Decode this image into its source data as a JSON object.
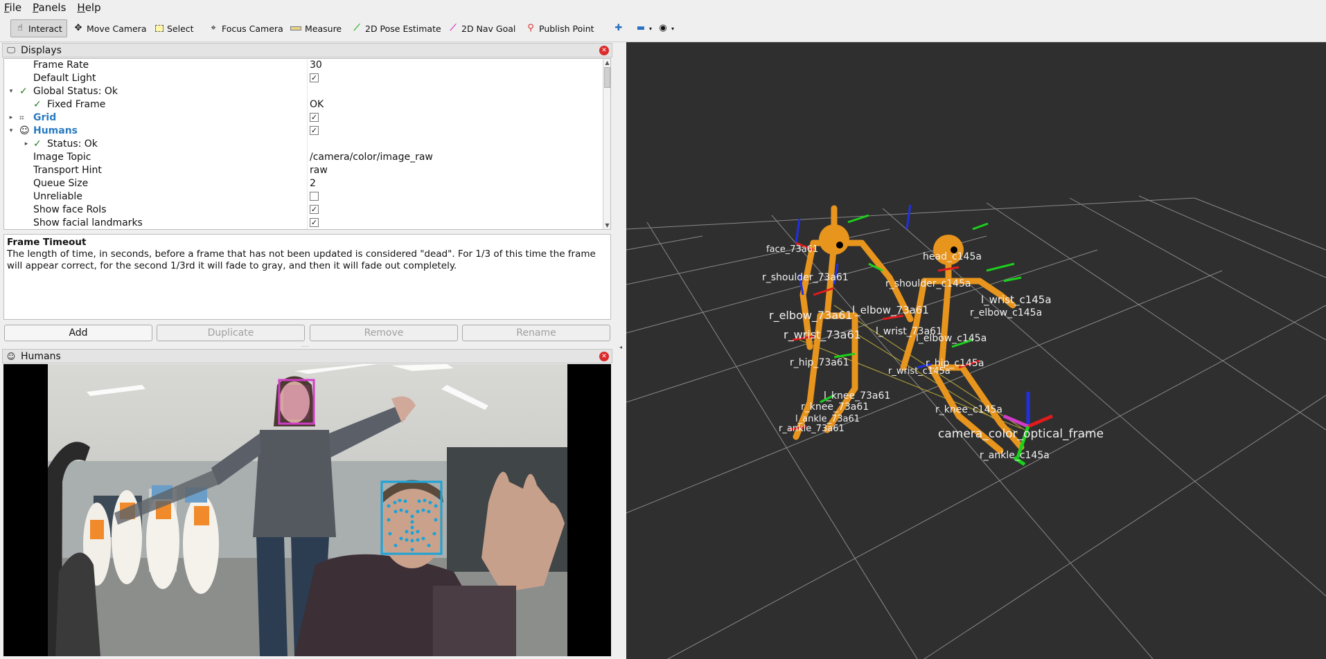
{
  "menu": [
    {
      "first": "F",
      "rest": "ile"
    },
    {
      "first": "P",
      "rest": "anels"
    },
    {
      "first": "H",
      "rest": "elp"
    }
  ],
  "toolbar": {
    "interact": "Interact",
    "move_camera": "Move Camera",
    "select": "Select",
    "focus_camera": "Focus Camera",
    "measure": "Measure",
    "pose_estimate": "2D Pose Estimate",
    "nav_goal": "2D Nav Goal",
    "publish_point": "Publish Point"
  },
  "displays_panel": {
    "title": "Displays",
    "rows": [
      {
        "label": "Frame Rate",
        "value": "30"
      },
      {
        "label": "Default Light",
        "checked": "✓"
      },
      {
        "label": "Global Status: Ok"
      },
      {
        "label": "Fixed Frame",
        "value": "OK"
      },
      {
        "label": "Grid",
        "checked": "✓"
      },
      {
        "label": "Humans",
        "checked": "✓"
      },
      {
        "label": "Status: Ok"
      },
      {
        "label": "Image Topic",
        "value": "/camera/color/image_raw"
      },
      {
        "label": "Transport Hint",
        "value": "raw"
      },
      {
        "label": "Queue Size",
        "value": "2"
      },
      {
        "label": "Unreliable",
        "checked": ""
      },
      {
        "label": "Show face RoIs",
        "checked": "✓"
      },
      {
        "label": "Show facial landmarks",
        "checked": "✓"
      }
    ]
  },
  "description": {
    "title": "Frame Timeout",
    "text": "The length of time, in seconds, before a frame that has not been updated is considered \"dead\". For 1/3 of this time the frame will appear correct, for the second 1/3rd it will fade to gray, and then it will fade out completely."
  },
  "buttons": {
    "add": "Add",
    "duplicate": "Duplicate",
    "remove": "Remove",
    "rename": "Rename"
  },
  "humans_panel": {
    "title": "Humans"
  },
  "viewport_labels": {
    "a1": "face_73a61",
    "a2": "r_shoulder_73a61",
    "a3": "l_elbow_73a61",
    "a4": "r_elbow_73a61",
    "a5": "r_wrist_73a61",
    "a6": "l_wrist_73a61",
    "a7": "r_hip_73a61",
    "a8": "l_knee_73a61",
    "a9": "r_knee_73a61",
    "a10": "l_ankle_73a61",
    "a11": "r_ankle_73a61",
    "b1": "head_c145a",
    "b2": "r_shoulder_c145a",
    "b3": "l_wrist_c145a",
    "b4": "l_elbow_c145a",
    "b5": "r_elbow_c145a",
    "b6": "r_hip_c145a",
    "b7": "r_wrist_c145a",
    "b8": "r_knee_c145a",
    "b9": "r_ankle_c145a",
    "cam": "camera_color_optical_frame"
  },
  "colors": {
    "skeleton": "#e8951e",
    "face_roi_magenta": "#d23cc8",
    "face_roi_cyan": "#1aa3d8",
    "axis_red": "#e01b1b",
    "axis_green": "#1bd11b",
    "axis_blue": "#2030e0",
    "ok_green": "#1a7f1a",
    "link_blue": "#2a7bc0"
  },
  "icons": {
    "interact": "hand-pointer-icon",
    "move": "move-arrows-icon",
    "select": "select-rect-icon",
    "focus": "focus-crosshair-icon",
    "measure": "ruler-icon",
    "pose": "green-arrow-icon",
    "goal": "magenta-arrow-icon",
    "point": "map-pin-icon",
    "plus": "plus-icon",
    "minus": "minus-icon",
    "eye": "eye-icon"
  }
}
